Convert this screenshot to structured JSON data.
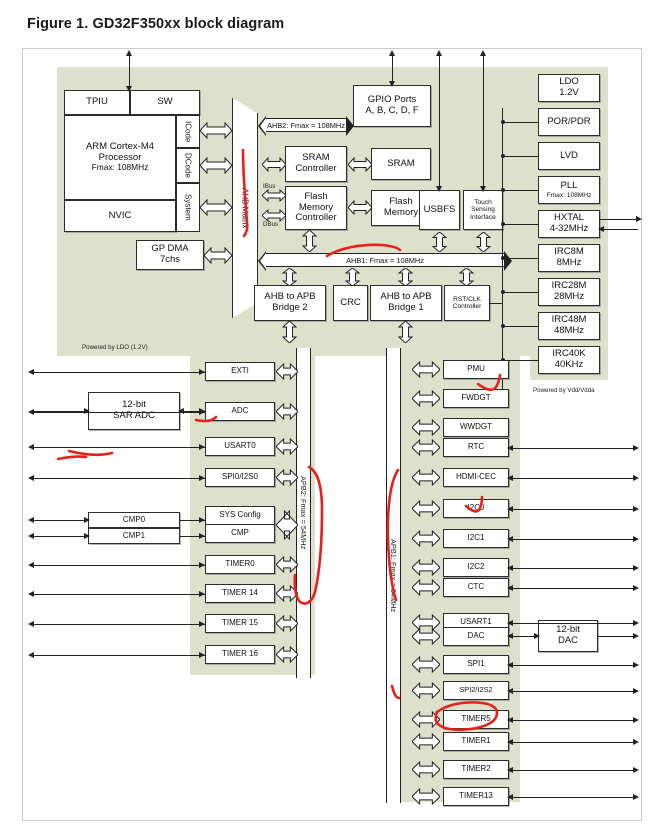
{
  "figure": {
    "title": "Figure 1. GD32F350xx block diagram"
  },
  "core": {
    "tpiu": "TPIU",
    "sw": "SW",
    "cpu_l1": "ARM Cortex-M4",
    "cpu_l2": "Processor",
    "cpu_l3": "Fmax: 108MHz",
    "nvic": "NVIC",
    "icode": "ICode",
    "dcode": "DCode",
    "system": "System",
    "gp_dma_l1": "GP DMA",
    "gp_dma_l2": "7chs",
    "ahb_matrix": "AHB Matrix"
  },
  "buses": {
    "ahb2": "AHB2: Fmax = 108MHz",
    "ahb1": "AHB1: Fmax = 108MHz",
    "apb2": "APB2: Fmax = 54MHz",
    "apb1": "APB1: Fmax = 54MHz",
    "ibus": "IBus",
    "dbus": "DBus"
  },
  "ahb_blocks": {
    "gpio_l1": "GPIO Ports",
    "gpio_l2": "A, B, C, D, F",
    "sram_ctrl_l1": "SRAM",
    "sram_ctrl_l2": "Controller",
    "sram": "SRAM",
    "flash_ctrl_l1": "Flash",
    "flash_ctrl_l2": "Memory",
    "flash_ctrl_l3": "Controller",
    "flash_l1": "Flash",
    "flash_l2": "Memory",
    "usbfs": "USBFS",
    "touch_l1": "Touch",
    "touch_l2": "Sensing",
    "touch_l3": "Interface"
  },
  "bridges": {
    "bridge2_l1": "AHB to APB",
    "bridge2_l2": "Bridge 2",
    "crc": "CRC",
    "bridge1_l1": "AHB to APB",
    "bridge1_l2": "Bridge 1",
    "rstclk_l1": "RST/CLK",
    "rstclk_l2": "Controller"
  },
  "clock_power": {
    "items": [
      {
        "l1": "LDO",
        "l2": "1.2V"
      },
      {
        "l1": "POR/PDR",
        "l2": ""
      },
      {
        "l1": "LVD",
        "l2": ""
      },
      {
        "l1": "PLL",
        "l2": "Fmax: 108MHz"
      },
      {
        "l1": "HXTAL",
        "l2": "4-32MHz"
      },
      {
        "l1": "IRC8M",
        "l2": "8MHz"
      },
      {
        "l1": "IRC28M",
        "l2": "28MHz"
      },
      {
        "l1": "IRC48M",
        "l2": "48MHz"
      },
      {
        "l1": "IRC40K",
        "l2": "40KHz"
      }
    ]
  },
  "apb2_peripherals": {
    "items": [
      {
        "label": "EXTI"
      },
      {
        "label": "ADC"
      },
      {
        "label": "USART0"
      },
      {
        "label": "SPI0/I2S0"
      },
      {
        "label": "SYS Config"
      },
      {
        "label": "CMP"
      },
      {
        "label": "TIMER0"
      },
      {
        "label": "TIMER 14"
      },
      {
        "label": "TIMER 15"
      },
      {
        "label": "TIMER 16"
      }
    ]
  },
  "apb1_peripherals": {
    "items": [
      {
        "label": "PMU"
      },
      {
        "label": "FWDGT"
      },
      {
        "label": "WWDGT"
      },
      {
        "label": "RTC"
      },
      {
        "label": "HDMI-CEC"
      },
      {
        "label": "I2C0"
      },
      {
        "label": "I2C1"
      },
      {
        "label": "I2C2"
      },
      {
        "label": "CTC"
      },
      {
        "label": "USART1"
      },
      {
        "label": "DAC"
      },
      {
        "label": "SPI1"
      },
      {
        "label": "SPI2/I2S2"
      },
      {
        "label": "TIMER5"
      },
      {
        "label": "TIMER1"
      },
      {
        "label": "TIMER2"
      },
      {
        "label": "TIMER13"
      }
    ]
  },
  "analog": {
    "sar_adc_l1": "12-bit",
    "sar_adc_l2": "SAR ADC",
    "cmp0": "CMP0",
    "cmp1": "CMP1",
    "dac_l1": "12-bit",
    "dac_l2": "DAC"
  },
  "notes": {
    "powered_ldo": "Powered by LDO (1.2V)",
    "powered_vdd": "Powered by Vdd/Vdda"
  },
  "colors": {
    "domain_fill": "#dde0cb",
    "block_fill": "#ffffff",
    "line": "#222222",
    "ink": "#e8201c"
  }
}
